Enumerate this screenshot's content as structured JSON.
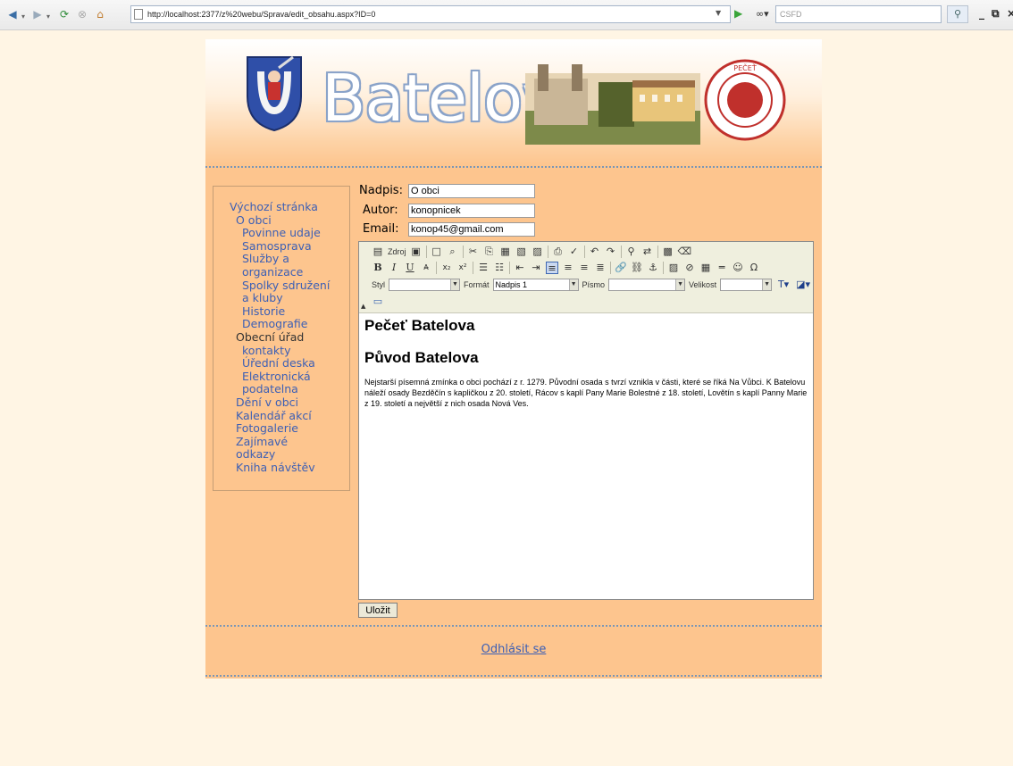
{
  "browser": {
    "url": "http://localhost:2377/z%20webu/Sprava/edit_obsahu.aspx?ID=0",
    "search_placeholder": "CSFD"
  },
  "site": {
    "logo_text": "Batelov.cz"
  },
  "sidebar": {
    "items": [
      {
        "label": "Výchozí stránka"
      },
      {
        "label": "O obci"
      },
      {
        "label": "Povinne udaje"
      },
      {
        "label": "Samosprava"
      },
      {
        "label": "Služby a"
      },
      {
        "label": "organizace"
      },
      {
        "label": "Spolky sdružení"
      },
      {
        "label": "a kluby"
      },
      {
        "label": "Historie"
      },
      {
        "label": "Demografie"
      },
      {
        "label": "Obecní úřad"
      },
      {
        "label": "kontakty"
      },
      {
        "label": "Úřední deska"
      },
      {
        "label": "Elektronická"
      },
      {
        "label": "podatelna"
      },
      {
        "label": "Dění v obci"
      },
      {
        "label": "Kalendář akcí"
      },
      {
        "label": "Fotogalerie"
      },
      {
        "label": "Zajímavé"
      },
      {
        "label": "odkazy"
      },
      {
        "label": "Kniha návštěv"
      }
    ]
  },
  "form": {
    "title_label": "Nadpis:",
    "title_value": "O obci",
    "author_label": "Autor:",
    "author_value": "konopnicek",
    "email_label": "Email:",
    "email_value": "konop45@gmail.com"
  },
  "toolbar": {
    "source_label": "Zdroj",
    "style_label": "Styl",
    "style_value": "",
    "format_label": "Formát",
    "format_value": "Nadpis 1",
    "font_label": "Písmo",
    "font_value": "",
    "size_label": "Velikost",
    "size_value": ""
  },
  "content": {
    "heading1": "Pečeť Batelova",
    "heading2": "Původ Batelova",
    "paragraph": "Nejstarší písemná zmínka o obci pochází z r. 1279. Původní osada s tvrzí vznikla v části, které se říká Na Vůbci. K Batelovu náleží osady Bezděčín s kapličkou z 20. století, Rácov s kaplí Pany Marie Bolestné z 18. století, Lovětín s kaplí Panny Marie z 19. století a největší z nich osada Nová Ves."
  },
  "actions": {
    "save_label": "Uložit",
    "logout_label": "Odhlásit se"
  }
}
